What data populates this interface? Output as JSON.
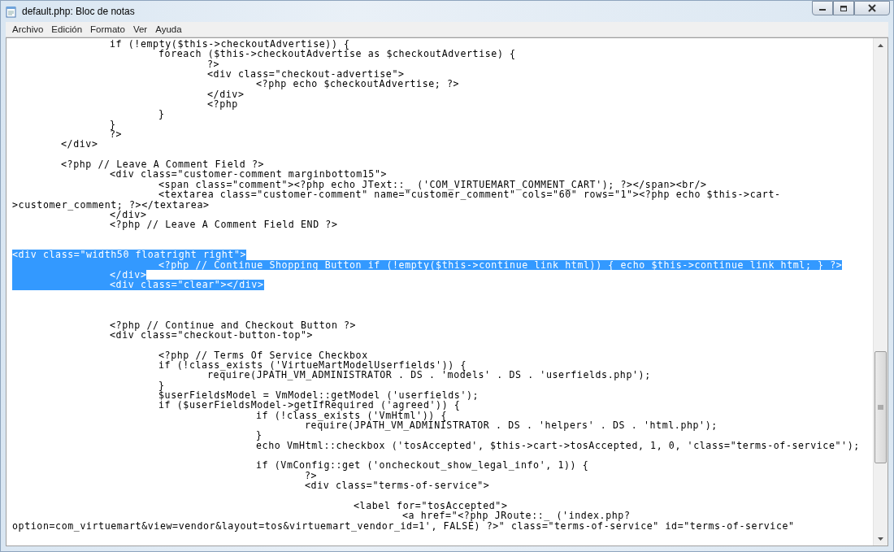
{
  "window": {
    "title": "default.php: Bloc de notas"
  },
  "menu": [
    {
      "label": "Archivo"
    },
    {
      "label": "Edición"
    },
    {
      "label": "Formato"
    },
    {
      "label": "Ver"
    },
    {
      "label": "Ayuda"
    }
  ],
  "editor": {
    "lines": [
      {
        "text": "\t\tif (!empty($this->checkoutAdvertise)) {",
        "selected": false
      },
      {
        "text": "\t\t\tforeach ($this->checkoutAdvertise as $checkoutAdvertise) {",
        "selected": false
      },
      {
        "text": "\t\t\t\t?>",
        "selected": false
      },
      {
        "text": "\t\t\t\t<div class=\"checkout-advertise\">",
        "selected": false
      },
      {
        "text": "\t\t\t\t\t<?php echo $checkoutAdvertise; ?>",
        "selected": false
      },
      {
        "text": "\t\t\t\t</div>",
        "selected": false
      },
      {
        "text": "\t\t\t\t<?php",
        "selected": false
      },
      {
        "text": "\t\t\t}",
        "selected": false
      },
      {
        "text": "\t\t}",
        "selected": false
      },
      {
        "text": "\t\t?>",
        "selected": false
      },
      {
        "text": "\t</div>",
        "selected": false
      },
      {
        "text": "\n\t<?php // Leave A Comment Field ?>",
        "selected": false
      },
      {
        "text": "\t\t<div class=\"customer-comment marginbottom15\">",
        "selected": false
      },
      {
        "text": "\t\t\t<span class=\"comment\"><?php echo JText::_ ('COM_VIRTUEMART_COMMENT_CART'); ?></span><br/>",
        "selected": false
      },
      {
        "text": "\t\t\t<textarea class=\"customer-comment\" name=\"customer_comment\" cols=\"60\" rows=\"1\"><?php echo $this->cart-",
        "selected": false
      },
      {
        "text": ">customer_comment; ?></textarea>",
        "selected": false
      },
      {
        "text": "\t\t</div>",
        "selected": false
      },
      {
        "text": "\t\t<?php // Leave A Comment Field END ?>\n\n\n",
        "selected": false
      },
      {
        "text": "<div class=\"width50 floatright right\">",
        "selected": true
      },
      {
        "text": "\t\t\t<?php // Continue Shopping Button if (!empty($this->continue_link_html)) { echo $this->continue_link_html; } ?>",
        "selected": true
      },
      {
        "text": "\t\t</div>",
        "selected": true
      },
      {
        "text": "\t\t<div class=\"clear\"></div>",
        "selected": true
      },
      {
        "text": "\n\n\n\t\t<?php // Continue and Checkout Button ?>",
        "selected": false
      },
      {
        "text": "\t\t<div class=\"checkout-button-top\">",
        "selected": false
      },
      {
        "text": "\n\t\t\t<?php // Terms Of Service Checkbox",
        "selected": false
      },
      {
        "text": "\t\t\tif (!class_exists ('VirtueMartModelUserfields')) {",
        "selected": false
      },
      {
        "text": "\t\t\t\trequire(JPATH_VM_ADMINISTRATOR . DS . 'models' . DS . 'userfields.php');",
        "selected": false
      },
      {
        "text": "\t\t\t}",
        "selected": false
      },
      {
        "text": "\t\t\t$userFieldsModel = VmModel::getModel ('userfields');",
        "selected": false
      },
      {
        "text": "\t\t\tif ($userFieldsModel->getIfRequired ('agreed')) {",
        "selected": false
      },
      {
        "text": "\t\t\t\t\tif (!class_exists ('VmHtml')) {",
        "selected": false
      },
      {
        "text": "\t\t\t\t\t\trequire(JPATH_VM_ADMINISTRATOR . DS . 'helpers' . DS . 'html.php');",
        "selected": false
      },
      {
        "text": "\t\t\t\t\t}",
        "selected": false
      },
      {
        "text": "\t\t\t\t\techo VmHtml::checkbox ('tosAccepted', $this->cart->tosAccepted, 1, 0, 'class=\"terms-of-service\"');",
        "selected": false
      },
      {
        "text": "\n\t\t\t\t\tif (VmConfig::get ('oncheckout_show_legal_info', 1)) {",
        "selected": false
      },
      {
        "text": "\t\t\t\t\t\t?>",
        "selected": false
      },
      {
        "text": "\t\t\t\t\t\t<div class=\"terms-of-service\">",
        "selected": false
      },
      {
        "text": "\n\t\t\t\t\t\t\t<label for=\"tosAccepted\">",
        "selected": false
      },
      {
        "text": "\t\t\t\t\t\t\t\t<a href=\"<?php JRoute::_ ('index.php?",
        "selected": false
      },
      {
        "text": "option=com_virtuemart&view=vendor&layout=tos&virtuemart_vendor_id=1', FALSE) ?>\" class=\"terms-of-service\" id=\"terms-of-service\"",
        "selected": false
      }
    ]
  }
}
